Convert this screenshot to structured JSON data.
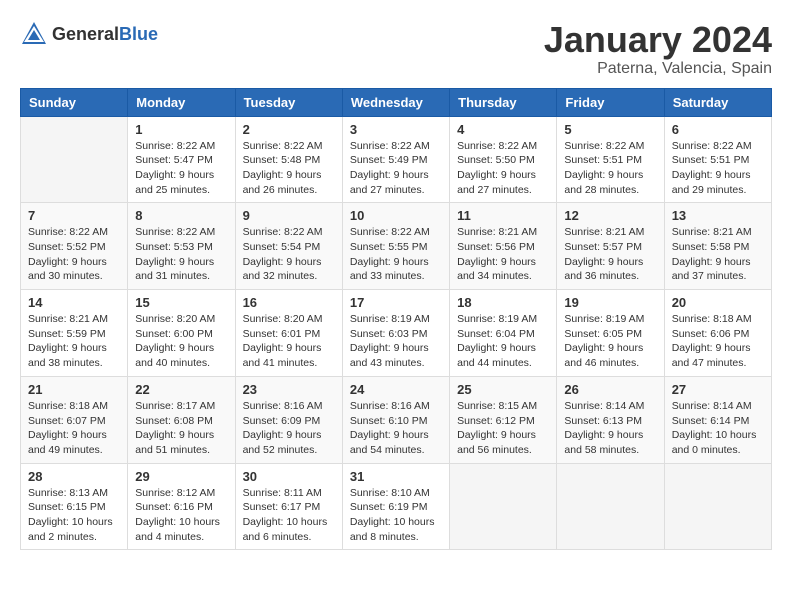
{
  "logo": {
    "general": "General",
    "blue": "Blue"
  },
  "header": {
    "month": "January 2024",
    "location": "Paterna, Valencia, Spain"
  },
  "weekdays": [
    "Sunday",
    "Monday",
    "Tuesday",
    "Wednesday",
    "Thursday",
    "Friday",
    "Saturday"
  ],
  "weeks": [
    [
      {
        "day": "",
        "sunrise": "",
        "sunset": "",
        "daylight": ""
      },
      {
        "day": "1",
        "sunrise": "Sunrise: 8:22 AM",
        "sunset": "Sunset: 5:47 PM",
        "daylight": "Daylight: 9 hours and 25 minutes."
      },
      {
        "day": "2",
        "sunrise": "Sunrise: 8:22 AM",
        "sunset": "Sunset: 5:48 PM",
        "daylight": "Daylight: 9 hours and 26 minutes."
      },
      {
        "day": "3",
        "sunrise": "Sunrise: 8:22 AM",
        "sunset": "Sunset: 5:49 PM",
        "daylight": "Daylight: 9 hours and 27 minutes."
      },
      {
        "day": "4",
        "sunrise": "Sunrise: 8:22 AM",
        "sunset": "Sunset: 5:50 PM",
        "daylight": "Daylight: 9 hours and 27 minutes."
      },
      {
        "day": "5",
        "sunrise": "Sunrise: 8:22 AM",
        "sunset": "Sunset: 5:51 PM",
        "daylight": "Daylight: 9 hours and 28 minutes."
      },
      {
        "day": "6",
        "sunrise": "Sunrise: 8:22 AM",
        "sunset": "Sunset: 5:51 PM",
        "daylight": "Daylight: 9 hours and 29 minutes."
      }
    ],
    [
      {
        "day": "7",
        "sunrise": "Sunrise: 8:22 AM",
        "sunset": "Sunset: 5:52 PM",
        "daylight": "Daylight: 9 hours and 30 minutes."
      },
      {
        "day": "8",
        "sunrise": "Sunrise: 8:22 AM",
        "sunset": "Sunset: 5:53 PM",
        "daylight": "Daylight: 9 hours and 31 minutes."
      },
      {
        "day": "9",
        "sunrise": "Sunrise: 8:22 AM",
        "sunset": "Sunset: 5:54 PM",
        "daylight": "Daylight: 9 hours and 32 minutes."
      },
      {
        "day": "10",
        "sunrise": "Sunrise: 8:22 AM",
        "sunset": "Sunset: 5:55 PM",
        "daylight": "Daylight: 9 hours and 33 minutes."
      },
      {
        "day": "11",
        "sunrise": "Sunrise: 8:21 AM",
        "sunset": "Sunset: 5:56 PM",
        "daylight": "Daylight: 9 hours and 34 minutes."
      },
      {
        "day": "12",
        "sunrise": "Sunrise: 8:21 AM",
        "sunset": "Sunset: 5:57 PM",
        "daylight": "Daylight: 9 hours and 36 minutes."
      },
      {
        "day": "13",
        "sunrise": "Sunrise: 8:21 AM",
        "sunset": "Sunset: 5:58 PM",
        "daylight": "Daylight: 9 hours and 37 minutes."
      }
    ],
    [
      {
        "day": "14",
        "sunrise": "Sunrise: 8:21 AM",
        "sunset": "Sunset: 5:59 PM",
        "daylight": "Daylight: 9 hours and 38 minutes."
      },
      {
        "day": "15",
        "sunrise": "Sunrise: 8:20 AM",
        "sunset": "Sunset: 6:00 PM",
        "daylight": "Daylight: 9 hours and 40 minutes."
      },
      {
        "day": "16",
        "sunrise": "Sunrise: 8:20 AM",
        "sunset": "Sunset: 6:01 PM",
        "daylight": "Daylight: 9 hours and 41 minutes."
      },
      {
        "day": "17",
        "sunrise": "Sunrise: 8:19 AM",
        "sunset": "Sunset: 6:03 PM",
        "daylight": "Daylight: 9 hours and 43 minutes."
      },
      {
        "day": "18",
        "sunrise": "Sunrise: 8:19 AM",
        "sunset": "Sunset: 6:04 PM",
        "daylight": "Daylight: 9 hours and 44 minutes."
      },
      {
        "day": "19",
        "sunrise": "Sunrise: 8:19 AM",
        "sunset": "Sunset: 6:05 PM",
        "daylight": "Daylight: 9 hours and 46 minutes."
      },
      {
        "day": "20",
        "sunrise": "Sunrise: 8:18 AM",
        "sunset": "Sunset: 6:06 PM",
        "daylight": "Daylight: 9 hours and 47 minutes."
      }
    ],
    [
      {
        "day": "21",
        "sunrise": "Sunrise: 8:18 AM",
        "sunset": "Sunset: 6:07 PM",
        "daylight": "Daylight: 9 hours and 49 minutes."
      },
      {
        "day": "22",
        "sunrise": "Sunrise: 8:17 AM",
        "sunset": "Sunset: 6:08 PM",
        "daylight": "Daylight: 9 hours and 51 minutes."
      },
      {
        "day": "23",
        "sunrise": "Sunrise: 8:16 AM",
        "sunset": "Sunset: 6:09 PM",
        "daylight": "Daylight: 9 hours and 52 minutes."
      },
      {
        "day": "24",
        "sunrise": "Sunrise: 8:16 AM",
        "sunset": "Sunset: 6:10 PM",
        "daylight": "Daylight: 9 hours and 54 minutes."
      },
      {
        "day": "25",
        "sunrise": "Sunrise: 8:15 AM",
        "sunset": "Sunset: 6:12 PM",
        "daylight": "Daylight: 9 hours and 56 minutes."
      },
      {
        "day": "26",
        "sunrise": "Sunrise: 8:14 AM",
        "sunset": "Sunset: 6:13 PM",
        "daylight": "Daylight: 9 hours and 58 minutes."
      },
      {
        "day": "27",
        "sunrise": "Sunrise: 8:14 AM",
        "sunset": "Sunset: 6:14 PM",
        "daylight": "Daylight: 10 hours and 0 minutes."
      }
    ],
    [
      {
        "day": "28",
        "sunrise": "Sunrise: 8:13 AM",
        "sunset": "Sunset: 6:15 PM",
        "daylight": "Daylight: 10 hours and 2 minutes."
      },
      {
        "day": "29",
        "sunrise": "Sunrise: 8:12 AM",
        "sunset": "Sunset: 6:16 PM",
        "daylight": "Daylight: 10 hours and 4 minutes."
      },
      {
        "day": "30",
        "sunrise": "Sunrise: 8:11 AM",
        "sunset": "Sunset: 6:17 PM",
        "daylight": "Daylight: 10 hours and 6 minutes."
      },
      {
        "day": "31",
        "sunrise": "Sunrise: 8:10 AM",
        "sunset": "Sunset: 6:19 PM",
        "daylight": "Daylight: 10 hours and 8 minutes."
      },
      {
        "day": "",
        "sunrise": "",
        "sunset": "",
        "daylight": ""
      },
      {
        "day": "",
        "sunrise": "",
        "sunset": "",
        "daylight": ""
      },
      {
        "day": "",
        "sunrise": "",
        "sunset": "",
        "daylight": ""
      }
    ]
  ]
}
